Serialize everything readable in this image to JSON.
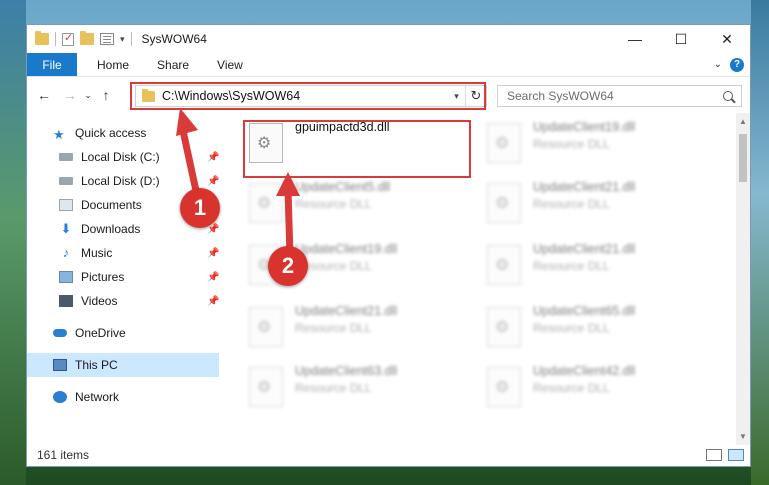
{
  "window": {
    "title": "SysWOW64",
    "controls": {
      "minimize": "—",
      "maximize": "☐",
      "close": "✕"
    }
  },
  "ribbon": {
    "tabs": [
      "File",
      "Home",
      "Share",
      "View"
    ]
  },
  "navbar": {
    "address": "C:\\Windows\\SysWOW64",
    "search_placeholder": "Search SysWOW64"
  },
  "sidebar": {
    "items": [
      {
        "label": "Quick access",
        "icon": "star-icon"
      },
      {
        "label": "Local Disk (C:)",
        "icon": "disk-icon",
        "pinned": true
      },
      {
        "label": "Local Disk (D:)",
        "icon": "disk-icon",
        "pinned": true
      },
      {
        "label": "Documents",
        "icon": "documents-icon",
        "pinned": true
      },
      {
        "label": "Downloads",
        "icon": "download-icon",
        "pinned": true
      },
      {
        "label": "Music",
        "icon": "music-icon",
        "pinned": true
      },
      {
        "label": "Pictures",
        "icon": "pictures-icon",
        "pinned": true
      },
      {
        "label": "Videos",
        "icon": "videos-icon",
        "pinned": true
      },
      {
        "label": "OneDrive",
        "icon": "onedrive-icon"
      },
      {
        "label": "This PC",
        "icon": "this-pc-icon",
        "selected": true
      },
      {
        "label": "Network",
        "icon": "network-icon"
      }
    ]
  },
  "files": [
    {
      "name": "gpuimpactd3d.dll",
      "type": ""
    },
    {
      "name": "UpdateClient19.dll",
      "type": "Resource DLL"
    },
    {
      "name": "UpdateClient5.dll",
      "type": "Resource DLL"
    },
    {
      "name": "UpdateClient21.dll",
      "type": "Resource DLL"
    },
    {
      "name": "UpdateClient19.dll",
      "type": "Resource DLL"
    },
    {
      "name": "UpdateClient21.dll",
      "type": "Resource DLL"
    },
    {
      "name": "UpdateClient21.dll",
      "type": "Resource DLL"
    },
    {
      "name": "UpdateClient65.dll",
      "type": "Resource DLL"
    },
    {
      "name": "UpdateClient63.dll",
      "type": "Resource DLL"
    },
    {
      "name": "UpdateClient42.dll",
      "type": "Resource DLL"
    }
  ],
  "status": {
    "count": "161 items"
  },
  "annotations": {
    "step1": "1",
    "step2": "2",
    "color": "#d93a3a"
  }
}
